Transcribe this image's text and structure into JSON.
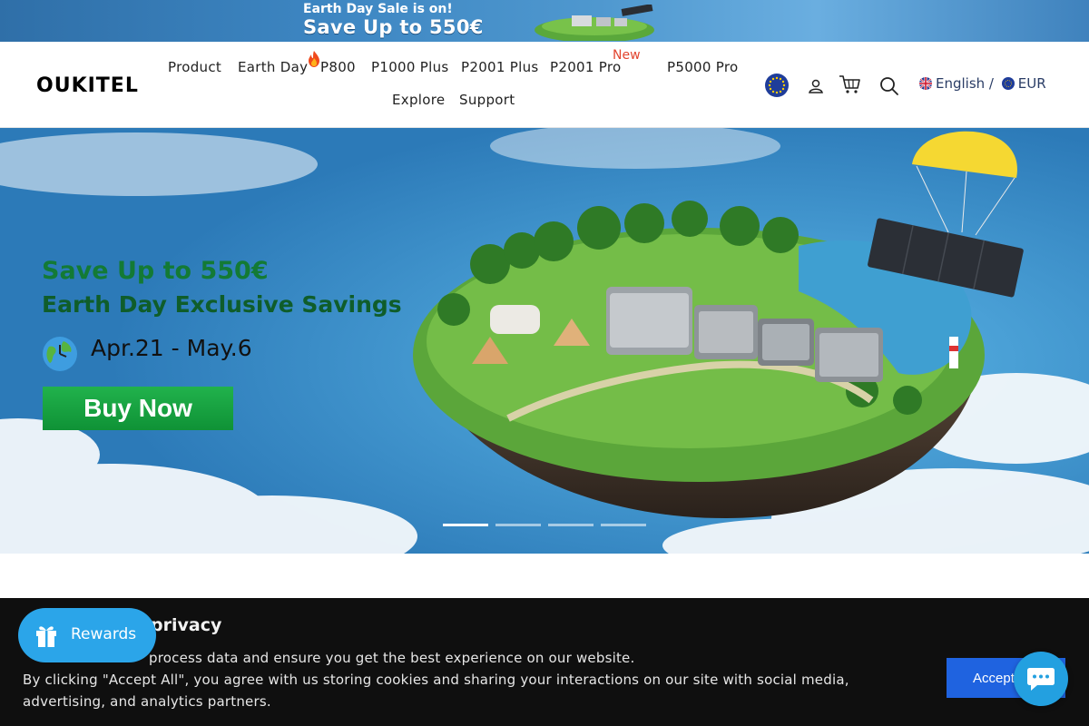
{
  "promo": {
    "line1": "Earth Day Sale is on!",
    "line2": "Save Up to 550€"
  },
  "header": {
    "logo": "OUKITEL",
    "nav": [
      "Product",
      "Earth Day",
      "P800",
      "P1000 Plus",
      "P2001 Plus",
      "P2001 Pro",
      "P5000 Pro",
      "Explore",
      "Support"
    ],
    "new_badge": "New",
    "icons": [
      "eu-flag-icon",
      "account-icon",
      "cart-icon",
      "search-icon"
    ],
    "language": "English /",
    "currency": "EUR"
  },
  "hero": {
    "headline": "Save Up to 550€",
    "subheadline": "Earth Day Exclusive Savings",
    "dates": "Apr.21 - May.6",
    "cta": "Buy Now",
    "slides_total": 4,
    "slide_active": 1,
    "colors": {
      "headline": "#137a35",
      "subheadline": "#0f5d2a",
      "cta": "#16a03f"
    }
  },
  "cookie": {
    "title": "privacy",
    "line1": "process data and ensure you get the best experience on our website.",
    "line2": "By clicking \"Accept All\", you agree with us storing cookies and sharing your interactions on our site with social media, advertising, and analytics partners.",
    "accept": "Accept"
  },
  "widgets": {
    "rewards": "Rewards",
    "chat_icon": "chat-bubble-icon"
  }
}
